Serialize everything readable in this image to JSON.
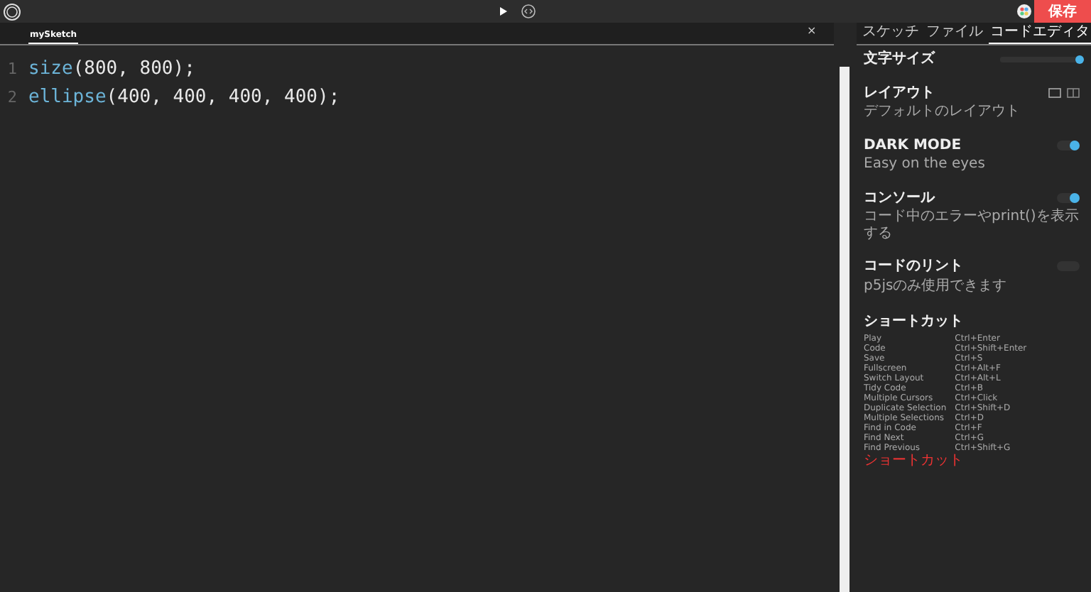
{
  "toolbar": {
    "save_button": "保存"
  },
  "editor_tabs": [
    {
      "label": "mySketch",
      "selected": true
    }
  ],
  "close_button": "×",
  "code_lines": [
    {
      "number": "1",
      "function": "size",
      "args": "(800, 800);"
    },
    {
      "number": "2",
      "function": "ellipse",
      "args": "(400, 400, 400, 400);"
    }
  ],
  "panel_tabs": [
    {
      "label": "スケッチ",
      "selected": false
    },
    {
      "label": "ファイル",
      "selected": false
    },
    {
      "label": "コードエディタ",
      "selected": true
    }
  ],
  "settings": [
    {
      "kind": "slider",
      "label": "文字サイズ",
      "level": 1.0
    },
    {
      "kind": "layout",
      "label": "レイアウト",
      "description": "デフォルトのレイアウト"
    },
    {
      "kind": "toggle",
      "label": "DARK MODE",
      "description": "Easy on the eyes",
      "on": true
    },
    {
      "kind": "toggle",
      "label": "コンソール",
      "description": "コード中のエラーやprint()を表示する",
      "on": true
    },
    {
      "kind": "toggle",
      "label": "コードのリント",
      "description": "p5jsのみ使用できます",
      "on": false
    }
  ],
  "shortcuts": {
    "title": "ショートカット",
    "items": [
      {
        "action": "Play",
        "keys": "Ctrl+Enter"
      },
      {
        "action": "Code",
        "keys": "Ctrl+Shift+Enter"
      },
      {
        "action": "Save",
        "keys": "Ctrl+S"
      },
      {
        "action": "Fullscreen",
        "keys": "Ctrl+Alt+F"
      },
      {
        "action": "Switch Layout",
        "keys": "Ctrl+Alt+L"
      },
      {
        "action": "Tidy Code",
        "keys": "Ctrl+B"
      },
      {
        "action": "Multiple Cursors",
        "keys": "Ctrl+Click"
      },
      {
        "action": "Duplicate Selection",
        "keys": "Ctrl+Shift+D"
      },
      {
        "action": "Multiple Selections",
        "keys": "Ctrl+D"
      },
      {
        "action": "Find in Code",
        "keys": "Ctrl+F"
      },
      {
        "action": "Find Next",
        "keys": "Ctrl+G"
      },
      {
        "action": "Find Previous",
        "keys": "Ctrl+Shift+G"
      }
    ],
    "link": "ショートカット"
  }
}
